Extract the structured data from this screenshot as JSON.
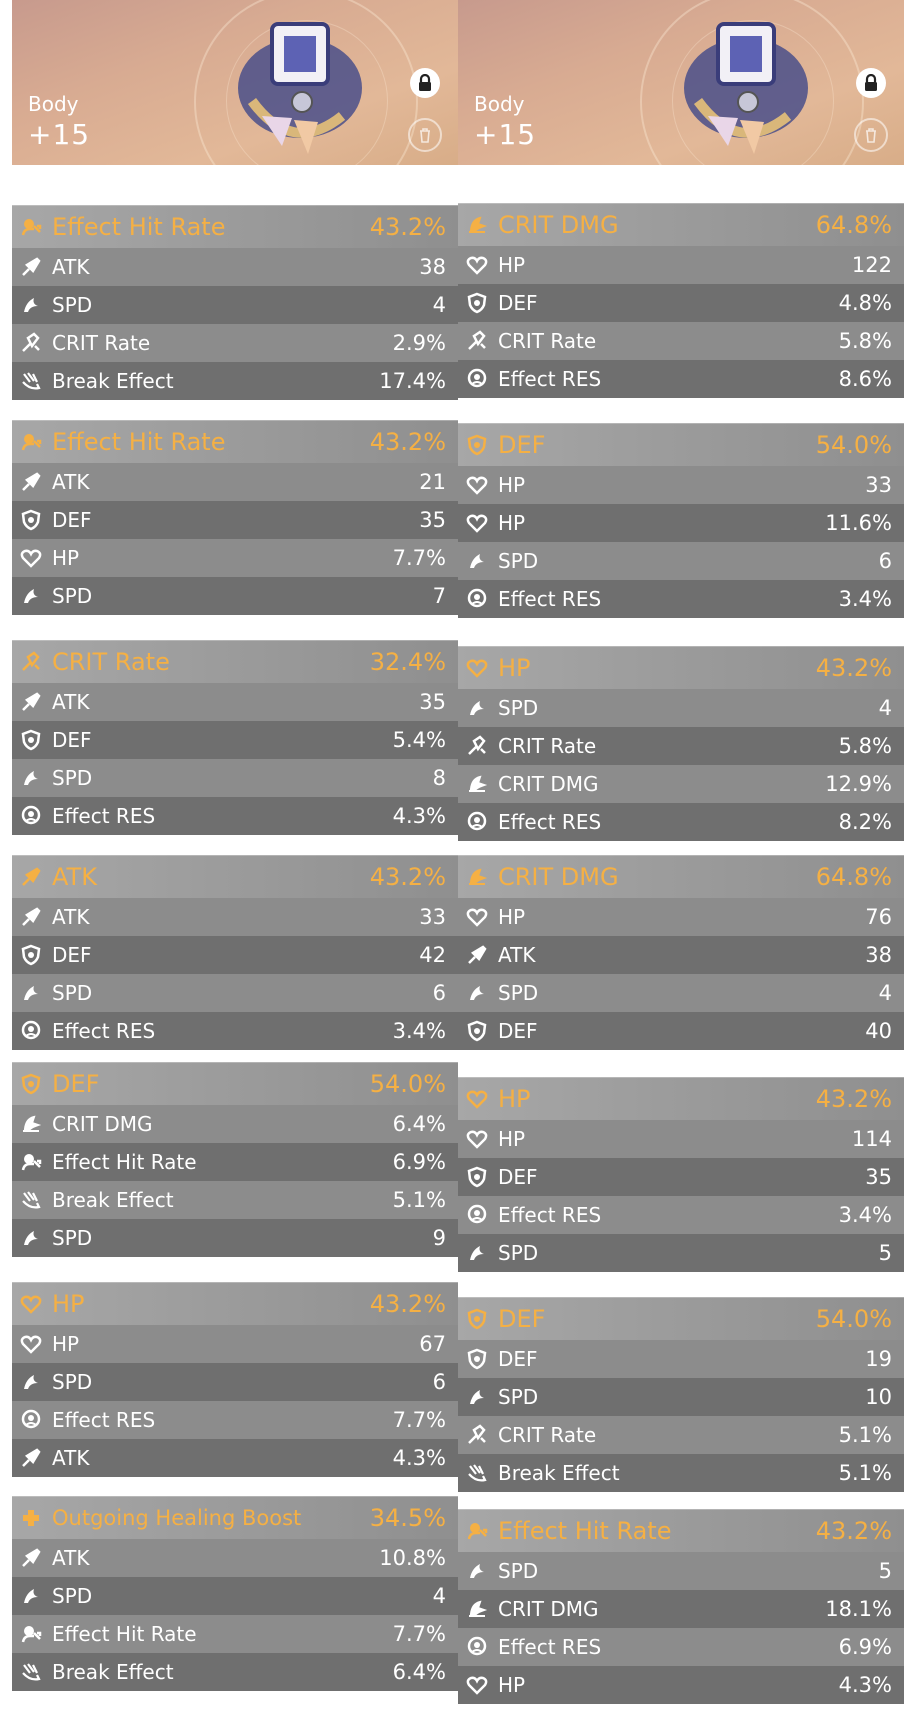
{
  "colors": {
    "main_stat": "#f5b044",
    "sub_text": "#ffffff",
    "row_light": "#8c8c8c",
    "row_dark": "#6f6f6f"
  },
  "header_left": {
    "slot": "Body",
    "level": "+15"
  },
  "header_right": {
    "slot": "Body",
    "level": "+15"
  },
  "left": [
    {
      "main": {
        "icon": "effect-hit-rate-icon",
        "name": "Effect Hit Rate",
        "value": "43.2%"
      },
      "subs": [
        {
          "icon": "atk-icon",
          "name": "ATK",
          "value": "38"
        },
        {
          "icon": "spd-icon",
          "name": "SPD",
          "value": "4"
        },
        {
          "icon": "crit-rate-icon",
          "name": "CRIT Rate",
          "value": "2.9%"
        },
        {
          "icon": "break-effect-icon",
          "name": "Break Effect",
          "value": "17.4%"
        }
      ]
    },
    {
      "main": {
        "icon": "effect-hit-rate-icon",
        "name": "Effect Hit Rate",
        "value": "43.2%"
      },
      "subs": [
        {
          "icon": "atk-icon",
          "name": "ATK",
          "value": "21"
        },
        {
          "icon": "def-icon",
          "name": "DEF",
          "value": "35"
        },
        {
          "icon": "hp-icon",
          "name": "HP",
          "value": "7.7%"
        },
        {
          "icon": "spd-icon",
          "name": "SPD",
          "value": "7"
        }
      ]
    },
    {
      "main": {
        "icon": "crit-rate-icon",
        "name": "CRIT Rate",
        "value": "32.4%"
      },
      "subs": [
        {
          "icon": "atk-icon",
          "name": "ATK",
          "value": "35"
        },
        {
          "icon": "def-icon",
          "name": "DEF",
          "value": "5.4%"
        },
        {
          "icon": "spd-icon",
          "name": "SPD",
          "value": "8"
        },
        {
          "icon": "effect-res-icon",
          "name": "Effect RES",
          "value": "4.3%"
        }
      ]
    },
    {
      "main": {
        "icon": "atk-icon",
        "name": "ATK",
        "value": "43.2%"
      },
      "subs": [
        {
          "icon": "atk-icon",
          "name": "ATK",
          "value": "33"
        },
        {
          "icon": "def-icon",
          "name": "DEF",
          "value": "42"
        },
        {
          "icon": "spd-icon",
          "name": "SPD",
          "value": "6"
        },
        {
          "icon": "effect-res-icon",
          "name": "Effect RES",
          "value": "3.4%"
        }
      ]
    },
    {
      "main": {
        "icon": "def-icon",
        "name": "DEF",
        "value": "54.0%"
      },
      "subs": [
        {
          "icon": "crit-dmg-icon",
          "name": "CRIT DMG",
          "value": "6.4%"
        },
        {
          "icon": "effect-hit-rate-icon",
          "name": "Effect Hit Rate",
          "value": "6.9%"
        },
        {
          "icon": "break-effect-icon",
          "name": "Break Effect",
          "value": "5.1%"
        },
        {
          "icon": "spd-icon",
          "name": "SPD",
          "value": "9"
        }
      ]
    },
    {
      "main": {
        "icon": "hp-icon",
        "name": "HP",
        "value": "43.2%"
      },
      "subs": [
        {
          "icon": "hp-icon",
          "name": "HP",
          "value": "67"
        },
        {
          "icon": "spd-icon",
          "name": "SPD",
          "value": "6"
        },
        {
          "icon": "effect-res-icon",
          "name": "Effect RES",
          "value": "7.7%"
        },
        {
          "icon": "atk-icon",
          "name": "ATK",
          "value": "4.3%"
        }
      ]
    },
    {
      "main": {
        "icon": "outgoing-healing-icon",
        "name": "Outgoing Healing Boost",
        "value": "34.5%"
      },
      "subs": [
        {
          "icon": "atk-icon",
          "name": "ATK",
          "value": "10.8%"
        },
        {
          "icon": "spd-icon",
          "name": "SPD",
          "value": "4"
        },
        {
          "icon": "effect-hit-rate-icon",
          "name": "Effect Hit Rate",
          "value": "7.7%"
        },
        {
          "icon": "break-effect-icon",
          "name": "Break Effect",
          "value": "6.4%"
        }
      ]
    }
  ],
  "right": [
    {
      "main": {
        "icon": "crit-dmg-icon",
        "name": "CRIT DMG",
        "value": "64.8%"
      },
      "subs": [
        {
          "icon": "hp-icon",
          "name": "HP",
          "value": "122"
        },
        {
          "icon": "def-icon",
          "name": "DEF",
          "value": "4.8%"
        },
        {
          "icon": "crit-rate-icon",
          "name": "CRIT Rate",
          "value": "5.8%"
        },
        {
          "icon": "effect-res-icon",
          "name": "Effect RES",
          "value": "8.6%"
        }
      ]
    },
    {
      "main": {
        "icon": "def-icon",
        "name": "DEF",
        "value": "54.0%"
      },
      "subs": [
        {
          "icon": "hp-icon",
          "name": "HP",
          "value": "33"
        },
        {
          "icon": "hp-icon",
          "name": "HP",
          "value": "11.6%"
        },
        {
          "icon": "spd-icon",
          "name": "SPD",
          "value": "6"
        },
        {
          "icon": "effect-res-icon",
          "name": "Effect RES",
          "value": "3.4%"
        }
      ]
    },
    {
      "main": {
        "icon": "hp-icon",
        "name": "HP",
        "value": "43.2%"
      },
      "subs": [
        {
          "icon": "spd-icon",
          "name": "SPD",
          "value": "4"
        },
        {
          "icon": "crit-rate-icon",
          "name": "CRIT Rate",
          "value": "5.8%"
        },
        {
          "icon": "crit-dmg-icon",
          "name": "CRIT DMG",
          "value": "12.9%"
        },
        {
          "icon": "effect-res-icon",
          "name": "Effect RES",
          "value": "8.2%"
        }
      ]
    },
    {
      "main": {
        "icon": "crit-dmg-icon",
        "name": "CRIT DMG",
        "value": "64.8%"
      },
      "subs": [
        {
          "icon": "hp-icon",
          "name": "HP",
          "value": "76"
        },
        {
          "icon": "atk-icon",
          "name": "ATK",
          "value": "38"
        },
        {
          "icon": "spd-icon",
          "name": "SPD",
          "value": "4"
        },
        {
          "icon": "def-icon",
          "name": "DEF",
          "value": "40"
        }
      ]
    },
    {
      "main": {
        "icon": "hp-icon",
        "name": "HP",
        "value": "43.2%"
      },
      "subs": [
        {
          "icon": "hp-icon",
          "name": "HP",
          "value": "114"
        },
        {
          "icon": "def-icon",
          "name": "DEF",
          "value": "35"
        },
        {
          "icon": "effect-res-icon",
          "name": "Effect RES",
          "value": "3.4%"
        },
        {
          "icon": "spd-icon",
          "name": "SPD",
          "value": "5"
        }
      ]
    },
    {
      "main": {
        "icon": "def-icon",
        "name": "DEF",
        "value": "54.0%"
      },
      "subs": [
        {
          "icon": "def-icon",
          "name": "DEF",
          "value": "19"
        },
        {
          "icon": "spd-icon",
          "name": "SPD",
          "value": "10"
        },
        {
          "icon": "crit-rate-icon",
          "name": "CRIT Rate",
          "value": "5.1%"
        },
        {
          "icon": "break-effect-icon",
          "name": "Break Effect",
          "value": "5.1%"
        }
      ]
    },
    {
      "main": {
        "icon": "effect-hit-rate-icon",
        "name": "Effect Hit Rate",
        "value": "43.2%"
      },
      "subs": [
        {
          "icon": "spd-icon",
          "name": "SPD",
          "value": "5"
        },
        {
          "icon": "crit-dmg-icon",
          "name": "CRIT DMG",
          "value": "18.1%"
        },
        {
          "icon": "effect-res-icon",
          "name": "Effect RES",
          "value": "6.9%"
        },
        {
          "icon": "hp-icon",
          "name": "HP",
          "value": "4.3%"
        }
      ]
    }
  ]
}
